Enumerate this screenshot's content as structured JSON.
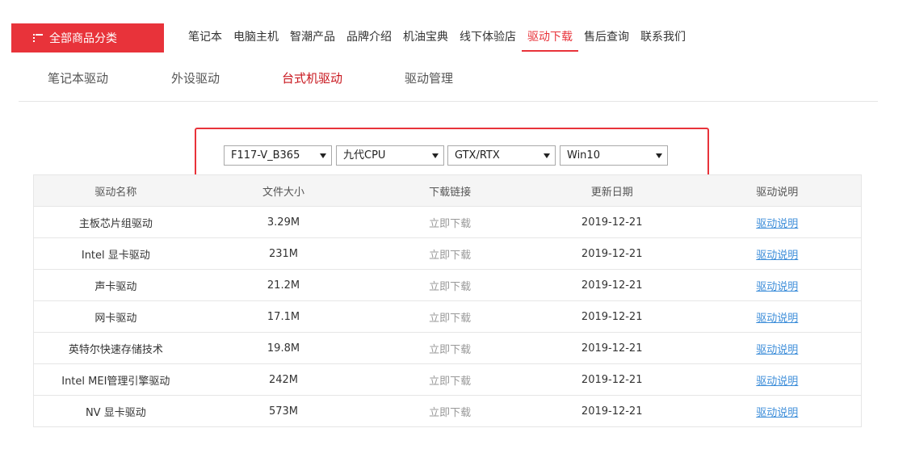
{
  "header": {
    "category_button": "全部商品分类",
    "nav": [
      {
        "label": "笔记本"
      },
      {
        "label": "电脑主机"
      },
      {
        "label": "智潮产品"
      },
      {
        "label": "品牌介绍"
      },
      {
        "label": "机油宝典"
      },
      {
        "label": "线下体验店"
      },
      {
        "label": "驱动下载",
        "active": true
      },
      {
        "label": "售后查询"
      },
      {
        "label": "联系我们"
      }
    ]
  },
  "subtabs": [
    {
      "label": "笔记本驱动"
    },
    {
      "label": "外设驱动"
    },
    {
      "label": "台式机驱动",
      "active": true
    },
    {
      "label": "驱动管理"
    }
  ],
  "filters": {
    "model": "F117-V_B365",
    "cpu": "九代CPU",
    "gpu": "GTX/RTX",
    "os": "Win10"
  },
  "table": {
    "headers": [
      "驱动名称",
      "文件大小",
      "下载链接",
      "更新日期",
      "驱动说明"
    ],
    "rows": [
      {
        "name": "主板芯片组驱动",
        "size": "3.29M",
        "link": "立即下载",
        "date": "2019-12-21",
        "desc": "驱动说明"
      },
      {
        "name": "Intel 显卡驱动",
        "size": "231M",
        "link": "立即下载",
        "date": "2019-12-21",
        "desc": "驱动说明"
      },
      {
        "name": "声卡驱动",
        "size": "21.2M",
        "link": "立即下载",
        "date": "2019-12-21",
        "desc": "驱动说明"
      },
      {
        "name": "网卡驱动",
        "size": "17.1M",
        "link": "立即下载",
        "date": "2019-12-21",
        "desc": "驱动说明"
      },
      {
        "name": "英特尔快速存储技术",
        "size": "19.8M",
        "link": "立即下载",
        "date": "2019-12-21",
        "desc": "驱动说明"
      },
      {
        "name": "Intel MEI管理引擎驱动",
        "size": "242M",
        "link": "立即下载",
        "date": "2019-12-21",
        "desc": "驱动说明"
      },
      {
        "name": "NV 显卡驱动",
        "size": "573M",
        "link": "立即下载",
        "date": "2019-12-21",
        "desc": "驱动说明"
      }
    ]
  },
  "colors": {
    "accent": "#e8333a",
    "active_text": "#c8161d",
    "link": "#3c8dd9"
  }
}
